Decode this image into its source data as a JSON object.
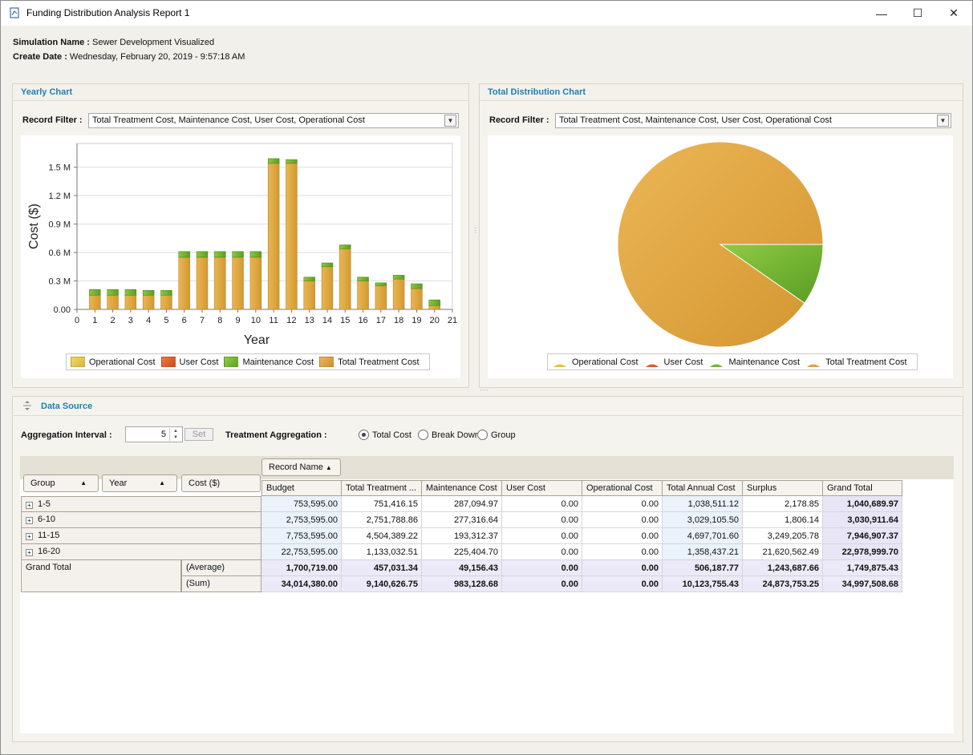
{
  "window": {
    "title": "Funding Distribution Analysis Report 1",
    "minimize": "—",
    "maximize": "☐",
    "close": "✕"
  },
  "meta": {
    "sim_label": "Simulation Name :",
    "sim_value": "Sewer Development Visualized",
    "date_label": "Create Date :",
    "date_value": "Wednesday, February 20, 2019 - 9:57:18 AM"
  },
  "yearly": {
    "title": "Yearly Chart",
    "filter_label": "Record Filter :",
    "filter_value": "Total Treatment Cost, Maintenance Cost, User Cost, Operational Cost"
  },
  "total": {
    "title": "Total Distribution Chart",
    "filter_label": "Record Filter :",
    "filter_value": "Total Treatment Cost, Maintenance Cost, User Cost, Operational Cost"
  },
  "legend": [
    {
      "name": "Operational Cost",
      "color": "#e2c34a"
    },
    {
      "name": "User Cost",
      "color": "#de5a2a"
    },
    {
      "name": "Maintenance Cost",
      "color": "#74b734"
    },
    {
      "name": "Total Treatment Cost",
      "color": "#dca240"
    }
  ],
  "chart_data": [
    {
      "type": "bar",
      "stacked": true,
      "xlabel": "Year",
      "ylabel": "Cost ($)",
      "x_ticks": [
        "0",
        "1",
        "2",
        "3",
        "4",
        "5",
        "6",
        "7",
        "8",
        "9",
        "10",
        "11",
        "12",
        "13",
        "14",
        "15",
        "16",
        "17",
        "18",
        "19",
        "20",
        "21"
      ],
      "y_ticks": [
        "0.00",
        "0.3 M",
        "0.6 M",
        "0.9 M",
        "1.2 M",
        "1.5 M"
      ],
      "ylim": [
        0,
        1.75
      ],
      "y_unit": "M",
      "categories": [
        1,
        2,
        3,
        4,
        5,
        6,
        7,
        8,
        9,
        10,
        11,
        12,
        13,
        14,
        15,
        16,
        17,
        18,
        19,
        20
      ],
      "series": [
        {
          "name": "Total Treatment Cost",
          "color": "#dca240",
          "values": [
            0.15,
            0.15,
            0.15,
            0.15,
            0.15,
            0.55,
            0.55,
            0.55,
            0.55,
            0.55,
            1.54,
            1.54,
            0.3,
            0.45,
            0.64,
            0.3,
            0.25,
            0.32,
            0.22,
            0.04
          ]
        },
        {
          "name": "Maintenance Cost",
          "color": "#74b734",
          "values": [
            0.06,
            0.06,
            0.06,
            0.05,
            0.05,
            0.06,
            0.06,
            0.06,
            0.06,
            0.06,
            0.05,
            0.04,
            0.04,
            0.04,
            0.04,
            0.04,
            0.03,
            0.04,
            0.05,
            0.06
          ]
        }
      ],
      "legend_position": "bottom"
    },
    {
      "type": "pie",
      "slices": [
        {
          "name": "Total Treatment Cost",
          "value": 90.3,
          "color": "#dca240"
        },
        {
          "name": "Maintenance Cost",
          "value": 9.7,
          "color": "#74b734"
        }
      ],
      "legend_position": "bottom"
    }
  ],
  "datasource": {
    "title": "Data Source",
    "agg_label": "Aggregation Interval :",
    "agg_value": "5",
    "set_label": "Set",
    "treat_label": "Treatment Aggregation :",
    "radios": [
      "Total Cost",
      "Break Down",
      "Group"
    ],
    "radio_selected": 0
  },
  "grid": {
    "record_name": "Record Name",
    "group_btn": "Group",
    "year_btn": "Year",
    "cost_btn": "Cost ($)",
    "columns": [
      "Budget",
      "Total Treatment ...",
      "Maintenance Cost",
      "User Cost",
      "Operational Cost",
      "Total Annual Cost",
      "Surplus",
      "Grand Total"
    ],
    "rows": [
      {
        "label": "1-5",
        "values": [
          "753,595.00",
          "751,416.15",
          "287,094.97",
          "0.00",
          "0.00",
          "1,038,511.12",
          "2,178.85",
          "1,040,689.97"
        ]
      },
      {
        "label": "6-10",
        "values": [
          "2,753,595.00",
          "2,751,788.86",
          "277,316.64",
          "0.00",
          "0.00",
          "3,029,105.50",
          "1,806.14",
          "3,030,911.64"
        ]
      },
      {
        "label": "11-15",
        "values": [
          "7,753,595.00",
          "4,504,389.22",
          "193,312.37",
          "0.00",
          "0.00",
          "4,697,701.60",
          "3,249,205.78",
          "7,946,907.37"
        ]
      },
      {
        "label": "16-20",
        "values": [
          "22,753,595.00",
          "1,133,032.51",
          "225,404.70",
          "0.00",
          "0.00",
          "1,358,437.21",
          "21,620,562.49",
          "22,978,999.70"
        ]
      }
    ],
    "grand_total_label": "Grand Total",
    "average_label": "(Average)",
    "sum_label": "(Sum)",
    "average": [
      "1,700,719.00",
      "457,031.34",
      "49,156.43",
      "0.00",
      "0.00",
      "506,187.77",
      "1,243,687.66",
      "1,749,875.43"
    ],
    "sum": [
      "34,014,380.00",
      "9,140,626.75",
      "983,128.68",
      "0.00",
      "0.00",
      "10,123,755.43",
      "24,873,753.25",
      "34,997,508.68"
    ]
  }
}
